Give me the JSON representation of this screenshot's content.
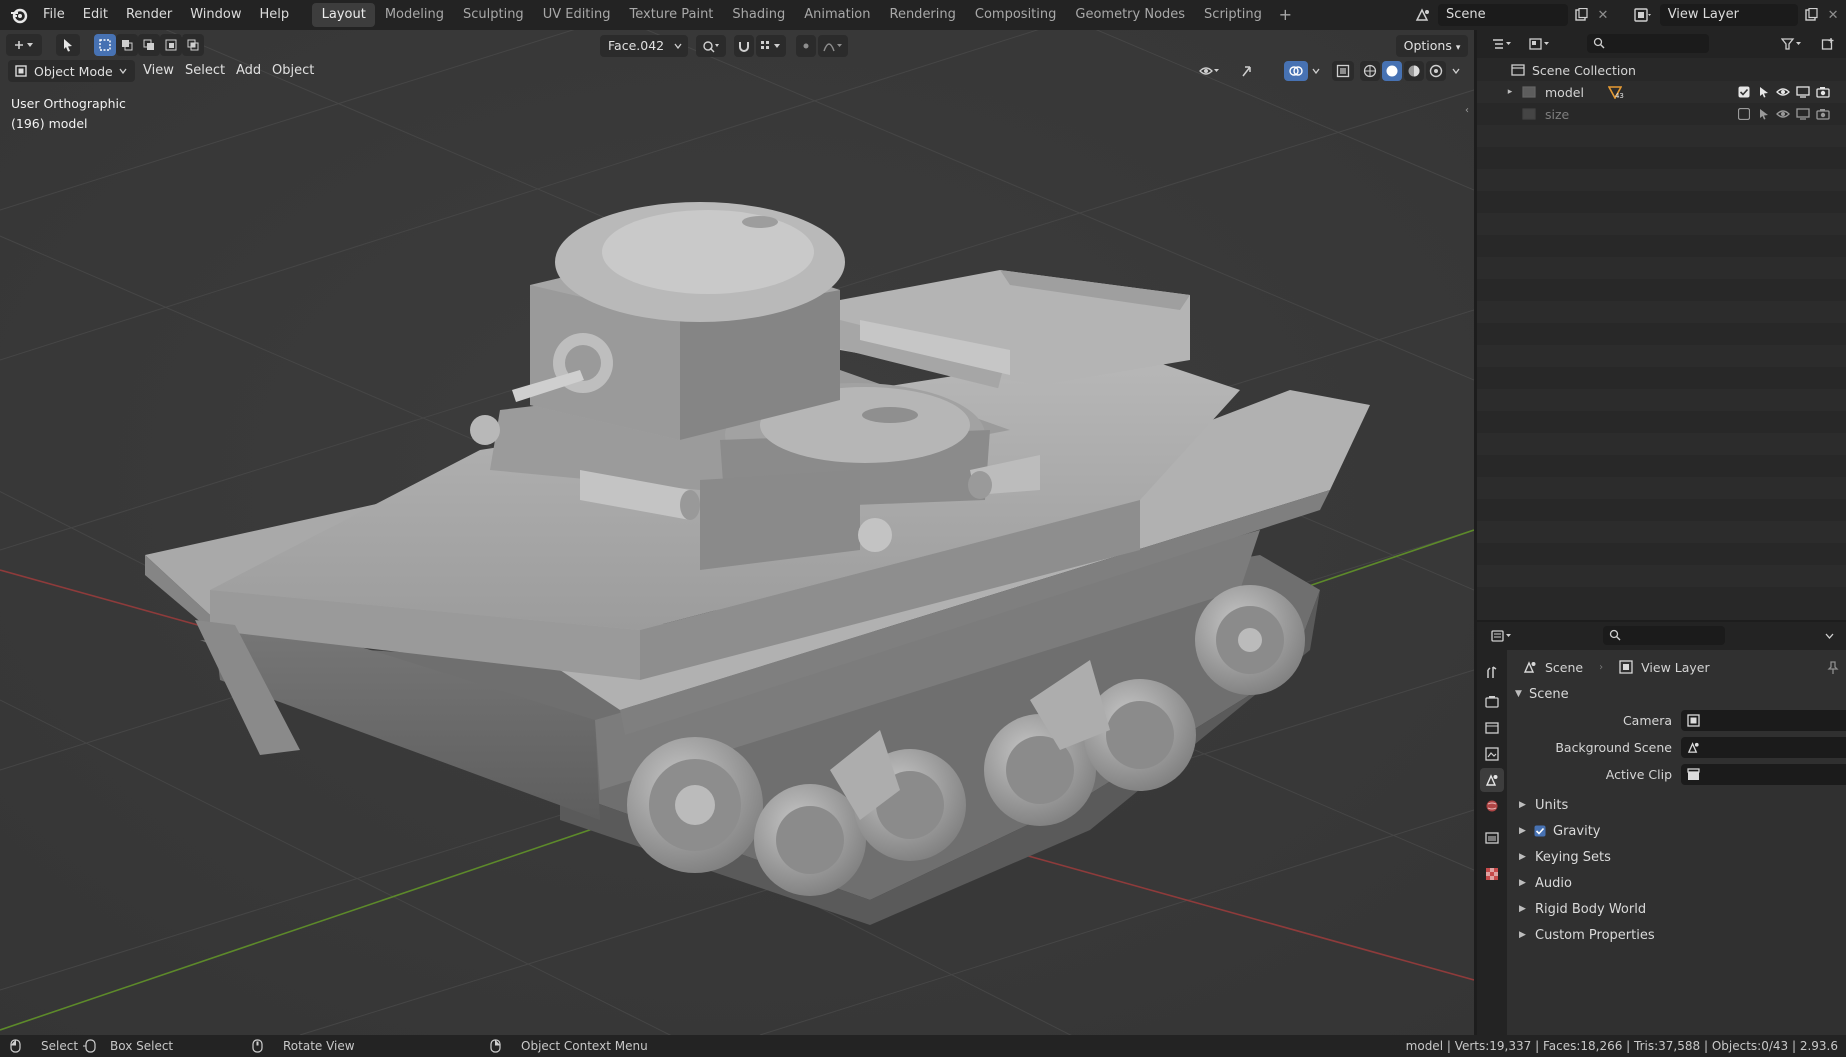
{
  "topbar": {
    "menus": [
      "File",
      "Edit",
      "Render",
      "Window",
      "Help"
    ],
    "workspaces": [
      "Layout",
      "Modeling",
      "Sculpting",
      "UV Editing",
      "Texture Paint",
      "Shading",
      "Animation",
      "Rendering",
      "Compositing",
      "Geometry Nodes",
      "Scripting"
    ],
    "active_workspace": "Layout",
    "plus": "+",
    "scene_name": "Scene",
    "view_layer_name": "View Layer"
  },
  "viewport": {
    "mode": "Object Mode",
    "menus": [
      "View",
      "Select",
      "Add",
      "Object"
    ],
    "view_name": "User Orthographic",
    "object_info": "(196) model",
    "active_element": "Face.042",
    "options_label": "Options"
  },
  "outliner": {
    "root": "Scene Collection",
    "items": [
      {
        "name": "model",
        "modifier_count": "43",
        "enabled": true
      },
      {
        "name": "size",
        "enabled": false
      }
    ]
  },
  "properties": {
    "breadcrumb_scene": "Scene",
    "breadcrumb_view_layer": "View Layer",
    "section": "Scene",
    "fields": {
      "camera_label": "Camera",
      "background_scene_label": "Background Scene",
      "active_clip_label": "Active Clip"
    },
    "panels": [
      {
        "label": "Units",
        "checkbox": false
      },
      {
        "label": "Gravity",
        "checkbox": true
      },
      {
        "label": "Keying Sets",
        "checkbox": false
      },
      {
        "label": "Audio",
        "checkbox": false
      },
      {
        "label": "Rigid Body World",
        "checkbox": false
      },
      {
        "label": "Custom Properties",
        "checkbox": false
      }
    ]
  },
  "statusbar": {
    "select": "Select",
    "box_select": "Box Select",
    "rotate_view": "Rotate View",
    "context_menu": "Object Context Menu",
    "stats": "model | Verts:19,337 | Faces:18,266 | Tris:37,588 | Objects:0/43 | 2.93.6"
  },
  "colors": {
    "accent": "#4772b3",
    "viewport_bg": "#393939",
    "x_axis": "#9a3b3b",
    "y_axis": "#6c9a2e"
  }
}
